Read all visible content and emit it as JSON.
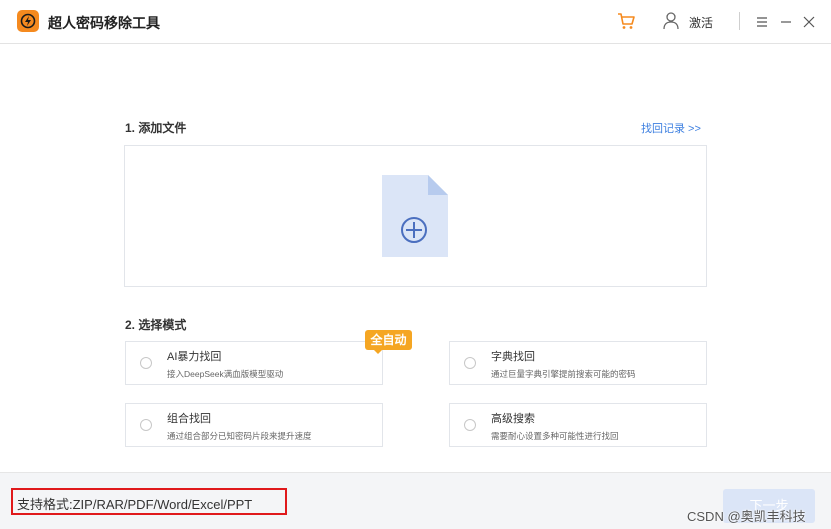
{
  "app": {
    "title": "超人密码移除工具"
  },
  "titlebar": {
    "cart_icon": "cart-icon",
    "user_icon": "user-icon",
    "activate_label": "激活",
    "menu_icon": "menu-icon",
    "minimize_icon": "minimize-icon",
    "close_icon": "close-icon"
  },
  "step1": {
    "title": "1. 添加文件",
    "history_link": "找回记录 >>",
    "drop_icon": "add-file-icon"
  },
  "step2": {
    "title": "2. 选择模式",
    "badge": "全自动",
    "modes": [
      {
        "title": "AI暴力找回",
        "desc": "接入DeepSeek满血版模型驱动"
      },
      {
        "title": "字典找回",
        "desc": "通过巨量字典引擎提前搜索可能的密码"
      },
      {
        "title": "组合找回",
        "desc": "通过组合部分已知密码片段来提升速度"
      },
      {
        "title": "高级搜索",
        "desc": "需要耐心设置多种可能性进行找回"
      }
    ]
  },
  "footer": {
    "formats": "支持格式:ZIP/RAR/PDF/Word/Excel/PPT",
    "next_label": "下一步",
    "watermark": "CSDN @奥凯丰科技"
  },
  "colors": {
    "accent": "#3d7fe0",
    "brand": "#f58a1f",
    "badge": "#f5a623",
    "highlight_border": "#e0191b",
    "file_icon": "#dbe5f7"
  }
}
